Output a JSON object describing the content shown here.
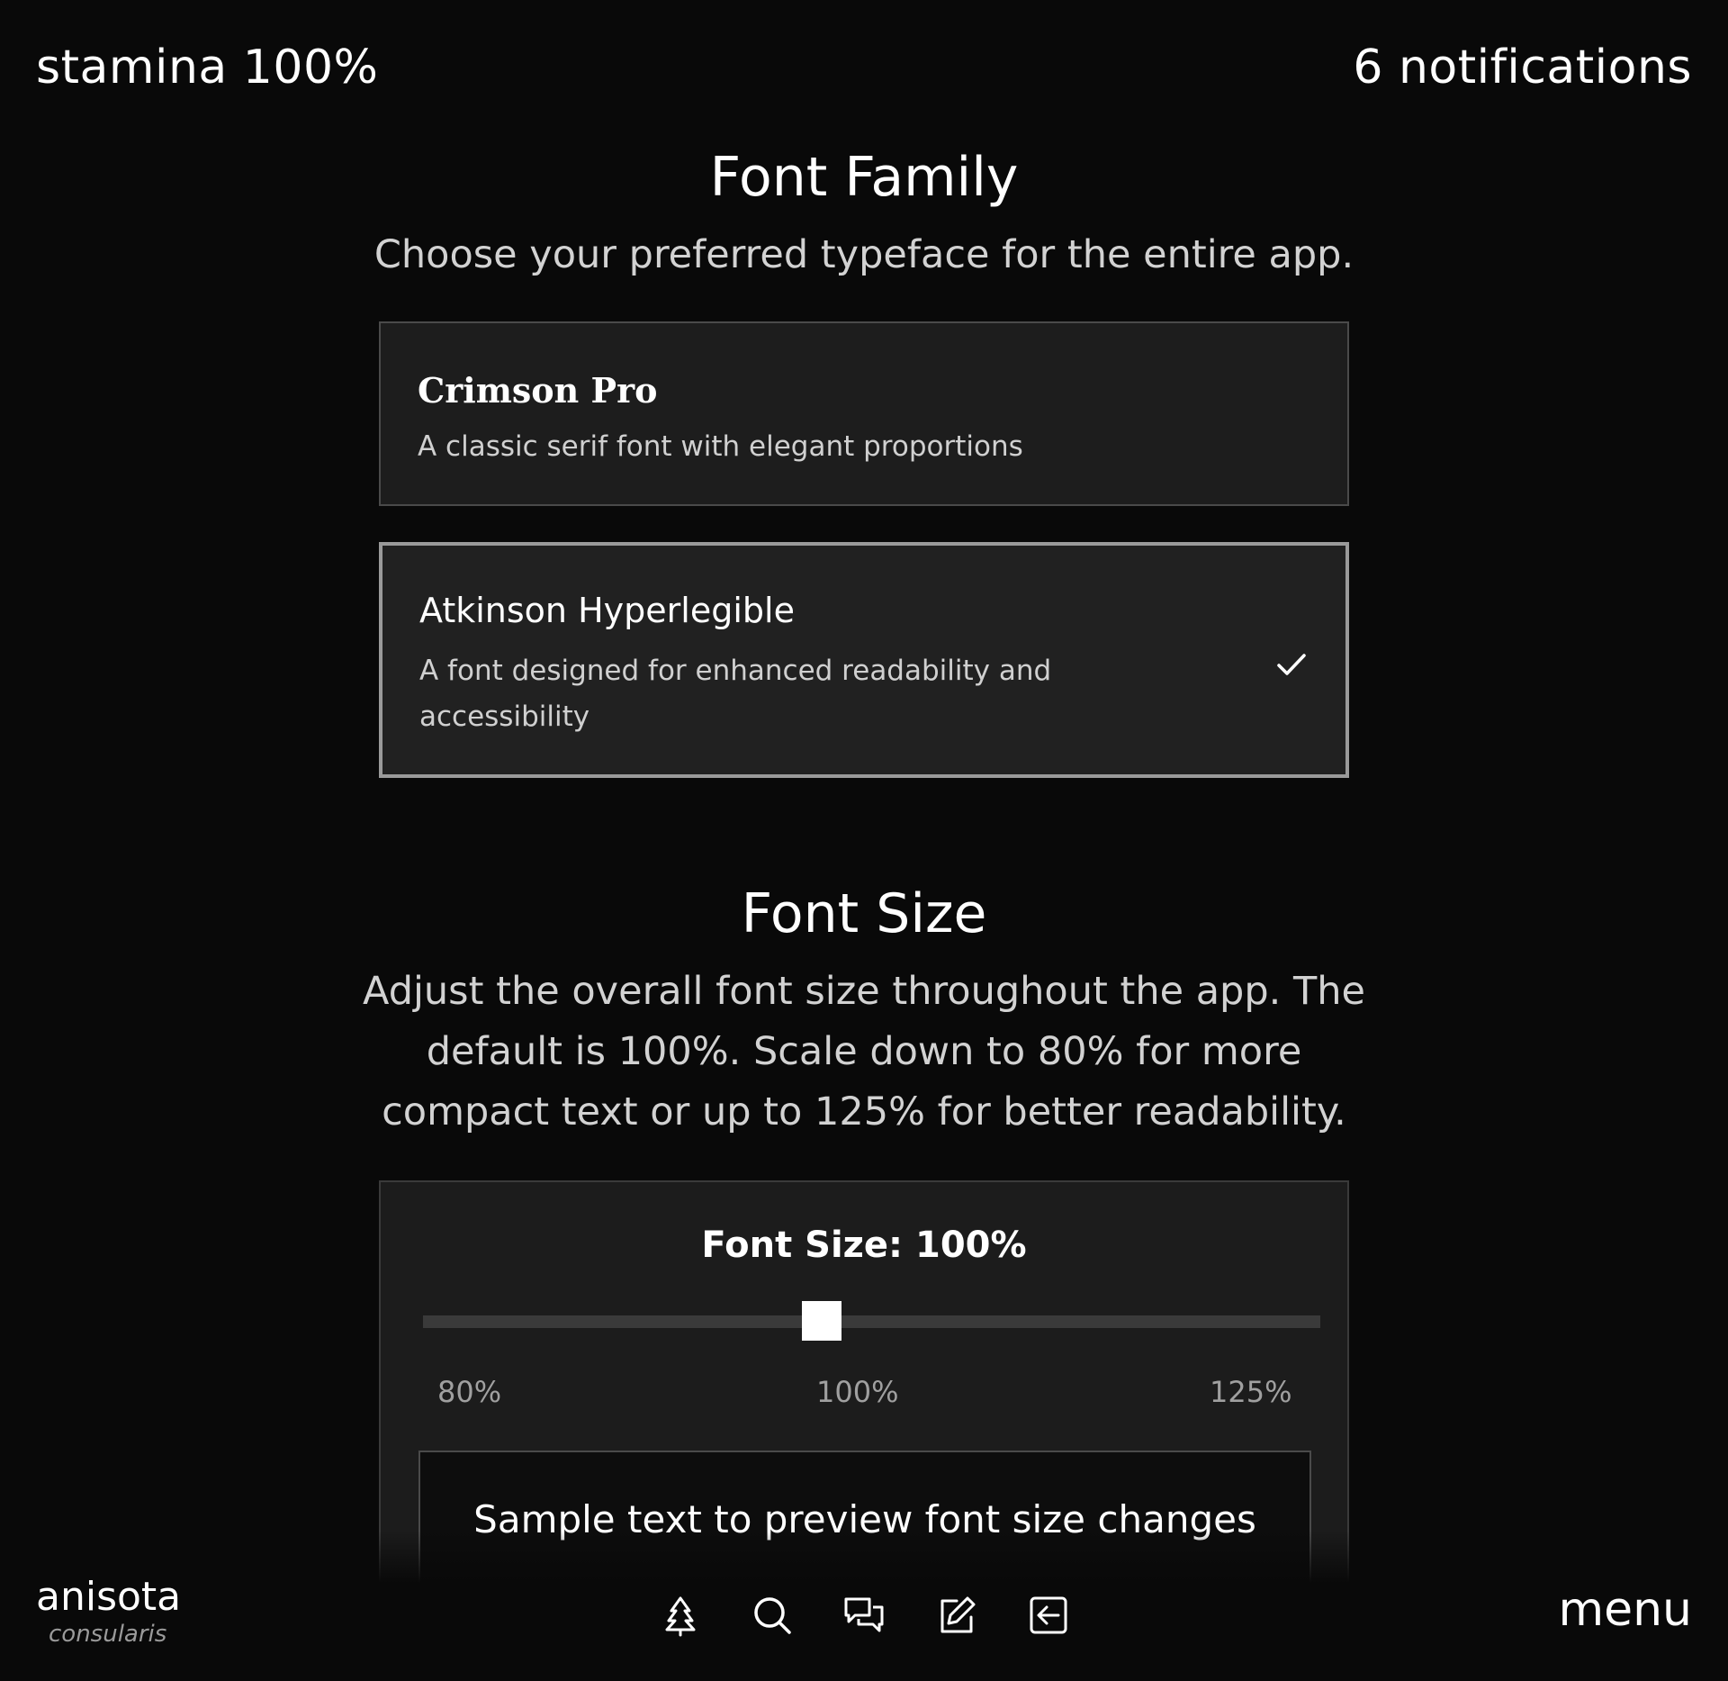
{
  "topbar": {
    "stamina": "stamina 100%",
    "notifications": "6 notifications"
  },
  "font_family": {
    "title": "Font Family",
    "description": "Choose your preferred typeface for the entire app.",
    "options": [
      {
        "name": "Crimson Pro",
        "description": "A classic serif font with elegant proportions",
        "selected": false
      },
      {
        "name": "Atkinson Hyperlegible",
        "description_line1": "A font designed for enhanced readability and",
        "description_line2": "accessibility",
        "selected": true
      }
    ]
  },
  "font_size": {
    "title": "Font Size",
    "description_lines": [
      "Adjust the overall font size throughout the app. The",
      "default is 100%. Scale down to 80% for more",
      "compact text or up to 125% for better readability."
    ],
    "label": "Font Size: 100%",
    "slider": {
      "min_label": "80%",
      "mid_label": "100%",
      "max_label": "125%",
      "min": 80,
      "max": 125,
      "value": 100
    },
    "sample_text": "Sample text to preview font size changes"
  },
  "brand": {
    "name": "anisota",
    "subtitle": "consularis"
  },
  "menu_label": "menu",
  "nav_icons": [
    "tree-icon",
    "search-icon",
    "chat-bubbles-icon",
    "edit-icon",
    "exit-icon"
  ]
}
